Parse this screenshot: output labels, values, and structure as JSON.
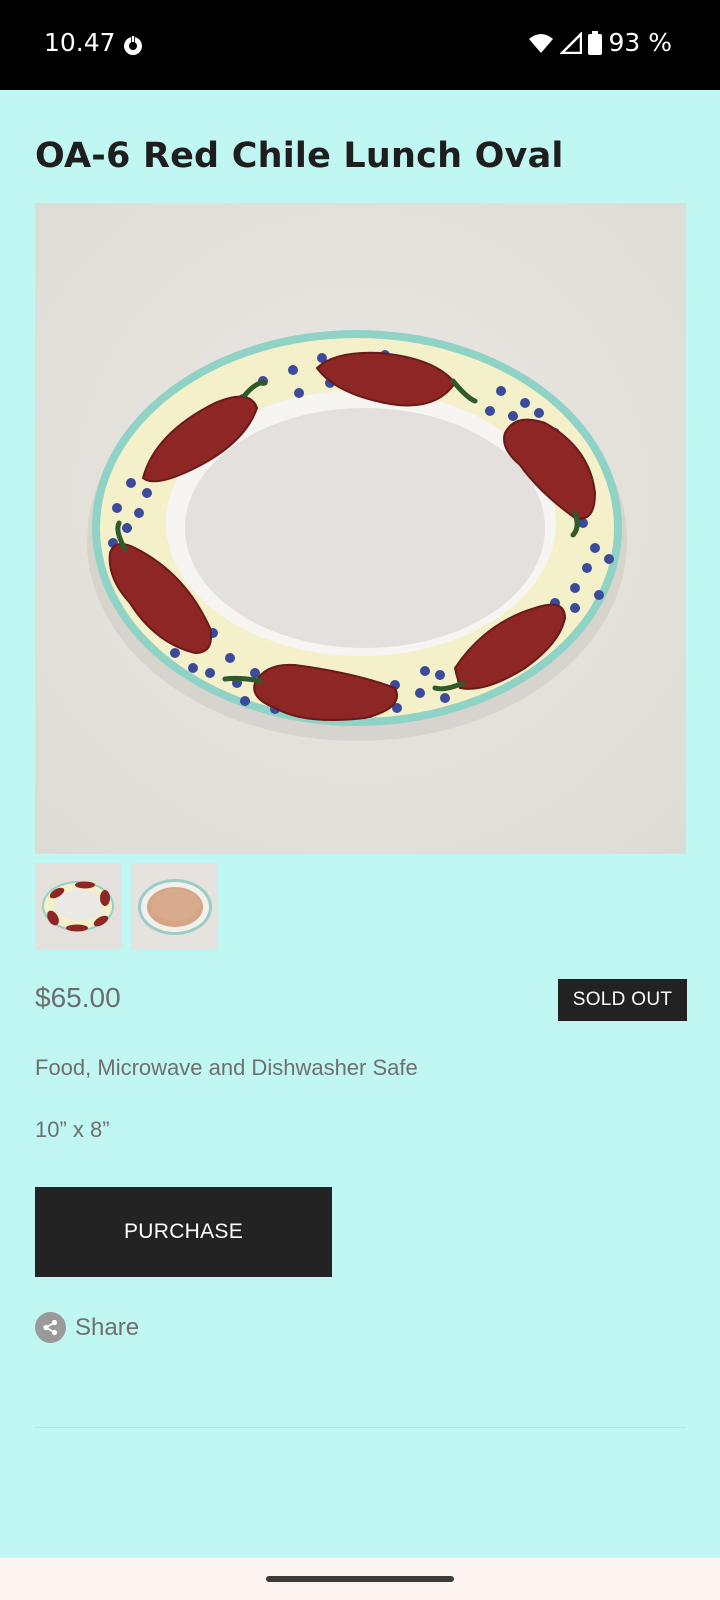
{
  "status_bar": {
    "time": "10.47",
    "battery": "93 %"
  },
  "product": {
    "title": "OA-6 Red Chile Lunch Oval",
    "price": "$65.00",
    "badge": "SOLD OUT",
    "description": "Food, Microwave and Dishwasher Safe",
    "dimensions": "10” x 8”",
    "purchase_label": "PURCHASE",
    "share_label": "Share"
  },
  "images": {
    "thumbnail_count": 2,
    "selected_thumbnail": 1
  },
  "colors": {
    "page_background": "#c1f7f3",
    "button": "#232323",
    "plate_rim": "#f4f0c9",
    "plate_edge": "#8fd2c6",
    "chile_red": "#8d2624",
    "dot_blue": "#3b4a9a"
  },
  "icons": [
    "app-notification-icon",
    "wifi-icon",
    "cell-signal-icon",
    "battery-icon",
    "share-icon"
  ]
}
